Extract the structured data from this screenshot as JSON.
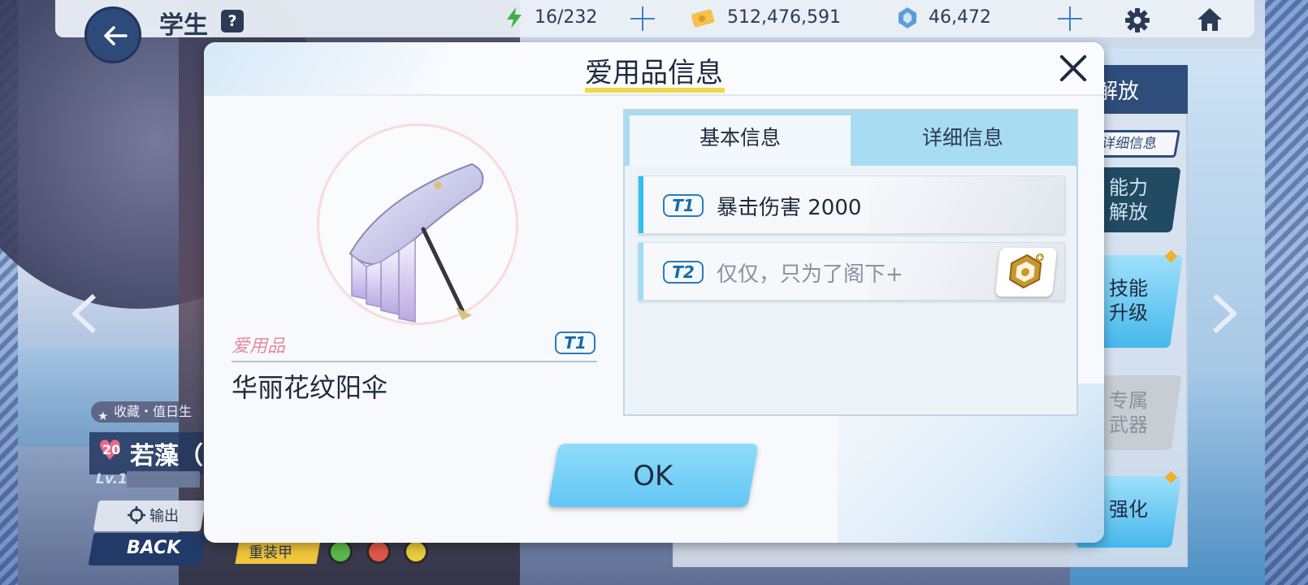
{
  "header": {
    "title": "学生",
    "help_label": "?",
    "ap": "16/232",
    "credits": "512,476,591",
    "pyroxene": "46,472"
  },
  "student": {
    "tag": "收藏・值日生",
    "bond_level": "20",
    "name": "若藻（",
    "level": "Lv.1",
    "output_label": "输出",
    "back_label": "BACK",
    "status_label": "重装甲"
  },
  "side_menu": {
    "header": "解放",
    "detail_chip": "详细信息",
    "items": [
      {
        "label": "能力解放"
      },
      {
        "label": "技能升级"
      },
      {
        "label": "专属武器"
      },
      {
        "label": "强化"
      }
    ]
  },
  "modal": {
    "title": "爱用品信息",
    "item": {
      "category": "爱用品",
      "tier": "T1",
      "name": "华丽花纹阳伞"
    },
    "tabs": [
      {
        "label": "基本信息",
        "active": true
      },
      {
        "label": "详细信息",
        "active": false
      }
    ],
    "effects": [
      {
        "tier": "T1",
        "text": "暴击伤害 2000",
        "active": true
      },
      {
        "tier": "T2",
        "text": "仅仅，只为了阁下+",
        "active": false
      }
    ],
    "ok_label": "OK"
  },
  "colors": {
    "accent": "#62c6f4",
    "title_underline": "#f2d74a",
    "item_category": "#e78a9c",
    "tier": "#1b6aa8"
  }
}
